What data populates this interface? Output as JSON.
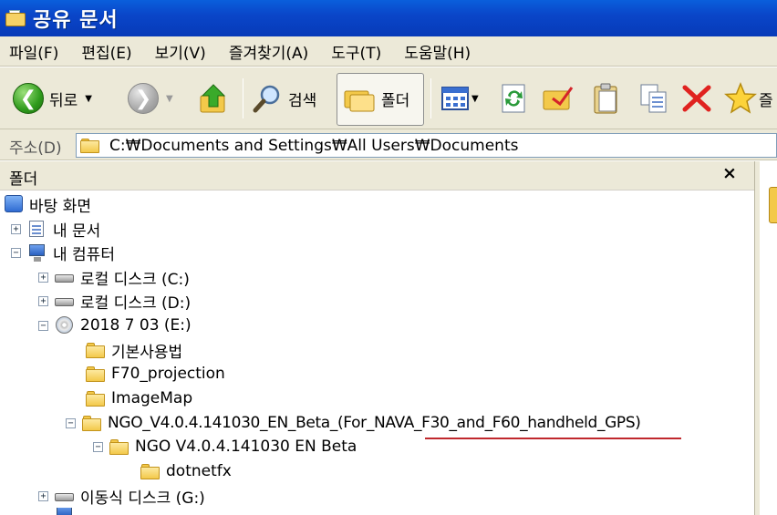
{
  "window": {
    "title": "공유 문서"
  },
  "menu": [
    "파일(F)",
    "편집(E)",
    "보기(V)",
    "즐겨찾기(A)",
    "도구(T)",
    "도움말(H)"
  ],
  "toolbar": {
    "back_label": "뒤로",
    "search_label": "검색",
    "folders_label": "폴더",
    "cut_label": "즐"
  },
  "address": {
    "label": "주소(D)",
    "path": "C:₩Documents and Settings₩All Users₩Documents"
  },
  "folders_pane": {
    "title": "폴더",
    "close": "×"
  },
  "tree": {
    "desktop": "바탕 화면",
    "my_documents": "내 문서",
    "my_computer": "내 컴퓨터",
    "drive_c": "로컬 디스크 (C:)",
    "drive_d": "로컬 디스크 (D:)",
    "drive_e": "2018 7 03 (E:)",
    "folder_basic": "기본사용법",
    "folder_f70": "F70_projection",
    "folder_imagemap": "ImageMap",
    "folder_ngo_long": "NGO_V4.0.4.141030_EN_Beta_(For_NAVA_F30_and_F60_handheld_GPS)",
    "folder_ngo": "NGO V4.0.4.141030 EN Beta",
    "folder_dotnetfx": "dotnetfx",
    "drive_g": "이동식 디스크 (G:)"
  },
  "colors": {
    "titlebar": "#0a46c9",
    "chrome": "#ece9d8",
    "highlight_line": "#c0282d"
  }
}
